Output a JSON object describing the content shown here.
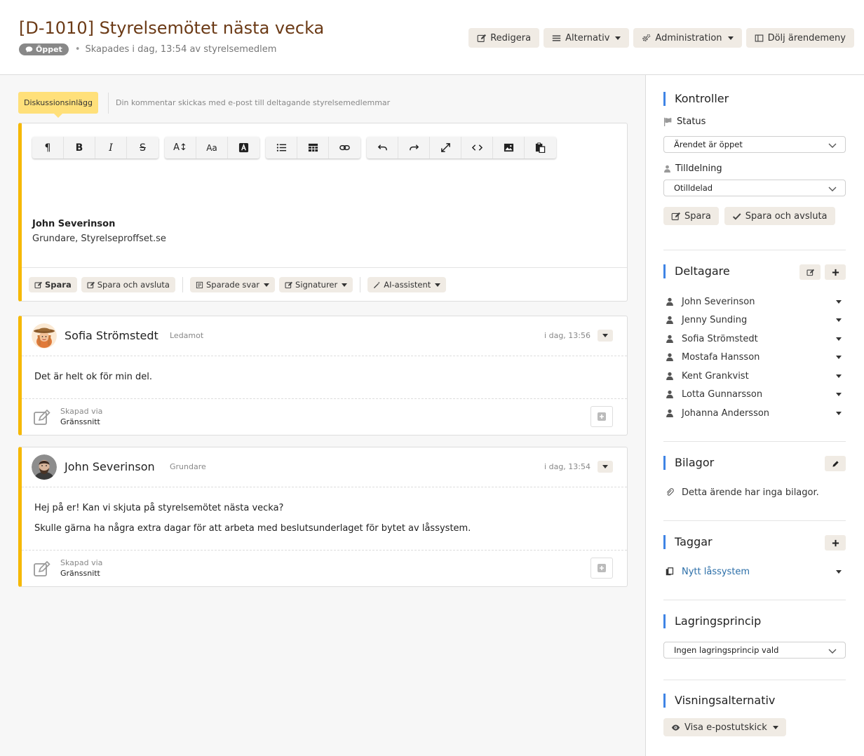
{
  "header": {
    "title": "[D-1010] Styrelsemötet nästa vecka",
    "status_badge": "Öppet",
    "meta": "Skapades i dag, 13:54 av styrelsemedlem",
    "actions": {
      "edit": "Redigera",
      "options": "Alternativ",
      "admin": "Administration",
      "hide_menu": "Dölj ärendemeny"
    }
  },
  "composer": {
    "tab_label": "Diskussionsinlägg",
    "hint": "Din kommentar skickas med e-post till deltagande styrelsemedlemmar",
    "toolbar": {
      "paragraph": "¶",
      "bold": "B",
      "italic": "I",
      "strike": "S",
      "font_size": "A↕",
      "font_family": "Aa"
    },
    "signature_name": "John Severinson",
    "signature_title": "Grundare, Styrelseproffset.se",
    "footer": {
      "save": "Spara",
      "save_close": "Spara och avsluta",
      "saved_replies": "Sparade svar",
      "signatures": "Signaturer",
      "ai_assistant": "AI-assistent"
    }
  },
  "posts": [
    {
      "author": "Sofia Strömstedt",
      "role": "Ledamot",
      "time": "i dag, 13:56",
      "paragraphs": [
        "Det är helt ok för min del."
      ],
      "via_label": "Skapad via",
      "via_value": "Gränssnitt"
    },
    {
      "author": "John Severinson",
      "role": "Grundare",
      "time": "i dag, 13:54",
      "paragraphs": [
        "Hej på er! Kan vi skjuta på styrelsemötet nästa vecka?",
        "Skulle gärna ha några extra dagar för att arbeta med beslutsunderlaget för bytet av låssystem."
      ],
      "via_label": "Skapad via",
      "via_value": "Gränssnitt"
    }
  ],
  "sidebar": {
    "controls": {
      "title": "Kontroller",
      "status_label": "Status",
      "status_value": "Ärendet är öppet",
      "assign_label": "Tilldelning",
      "assign_value": "Otilldelad",
      "save": "Spara",
      "save_close": "Spara och avsluta"
    },
    "participants": {
      "title": "Deltagare",
      "items": [
        "John Severinson",
        "Jenny Sunding",
        "Sofia Strömstedt",
        "Mostafa Hansson",
        "Kent Grankvist",
        "Lotta Gunnarsson",
        "Johanna Andersson"
      ]
    },
    "attachments": {
      "title": "Bilagor",
      "empty_text": "Detta ärende har inga bilagor."
    },
    "tags": {
      "title": "Taggar",
      "items": [
        "Nytt låssystem"
      ]
    },
    "retention": {
      "title": "Lagringsprincip",
      "value": "Ingen lagringsprincip vald"
    },
    "display": {
      "title": "Visningsalternativ",
      "button": "Visa e-postutskick"
    }
  },
  "colors": {
    "accent_yellow": "#f6b800",
    "tab_yellow": "#ffe07a",
    "title_brown": "#6b3a16",
    "section_blue": "#3f84e5",
    "button_beige": "#f0ebe4",
    "tag_link": "#2b6ea8"
  }
}
